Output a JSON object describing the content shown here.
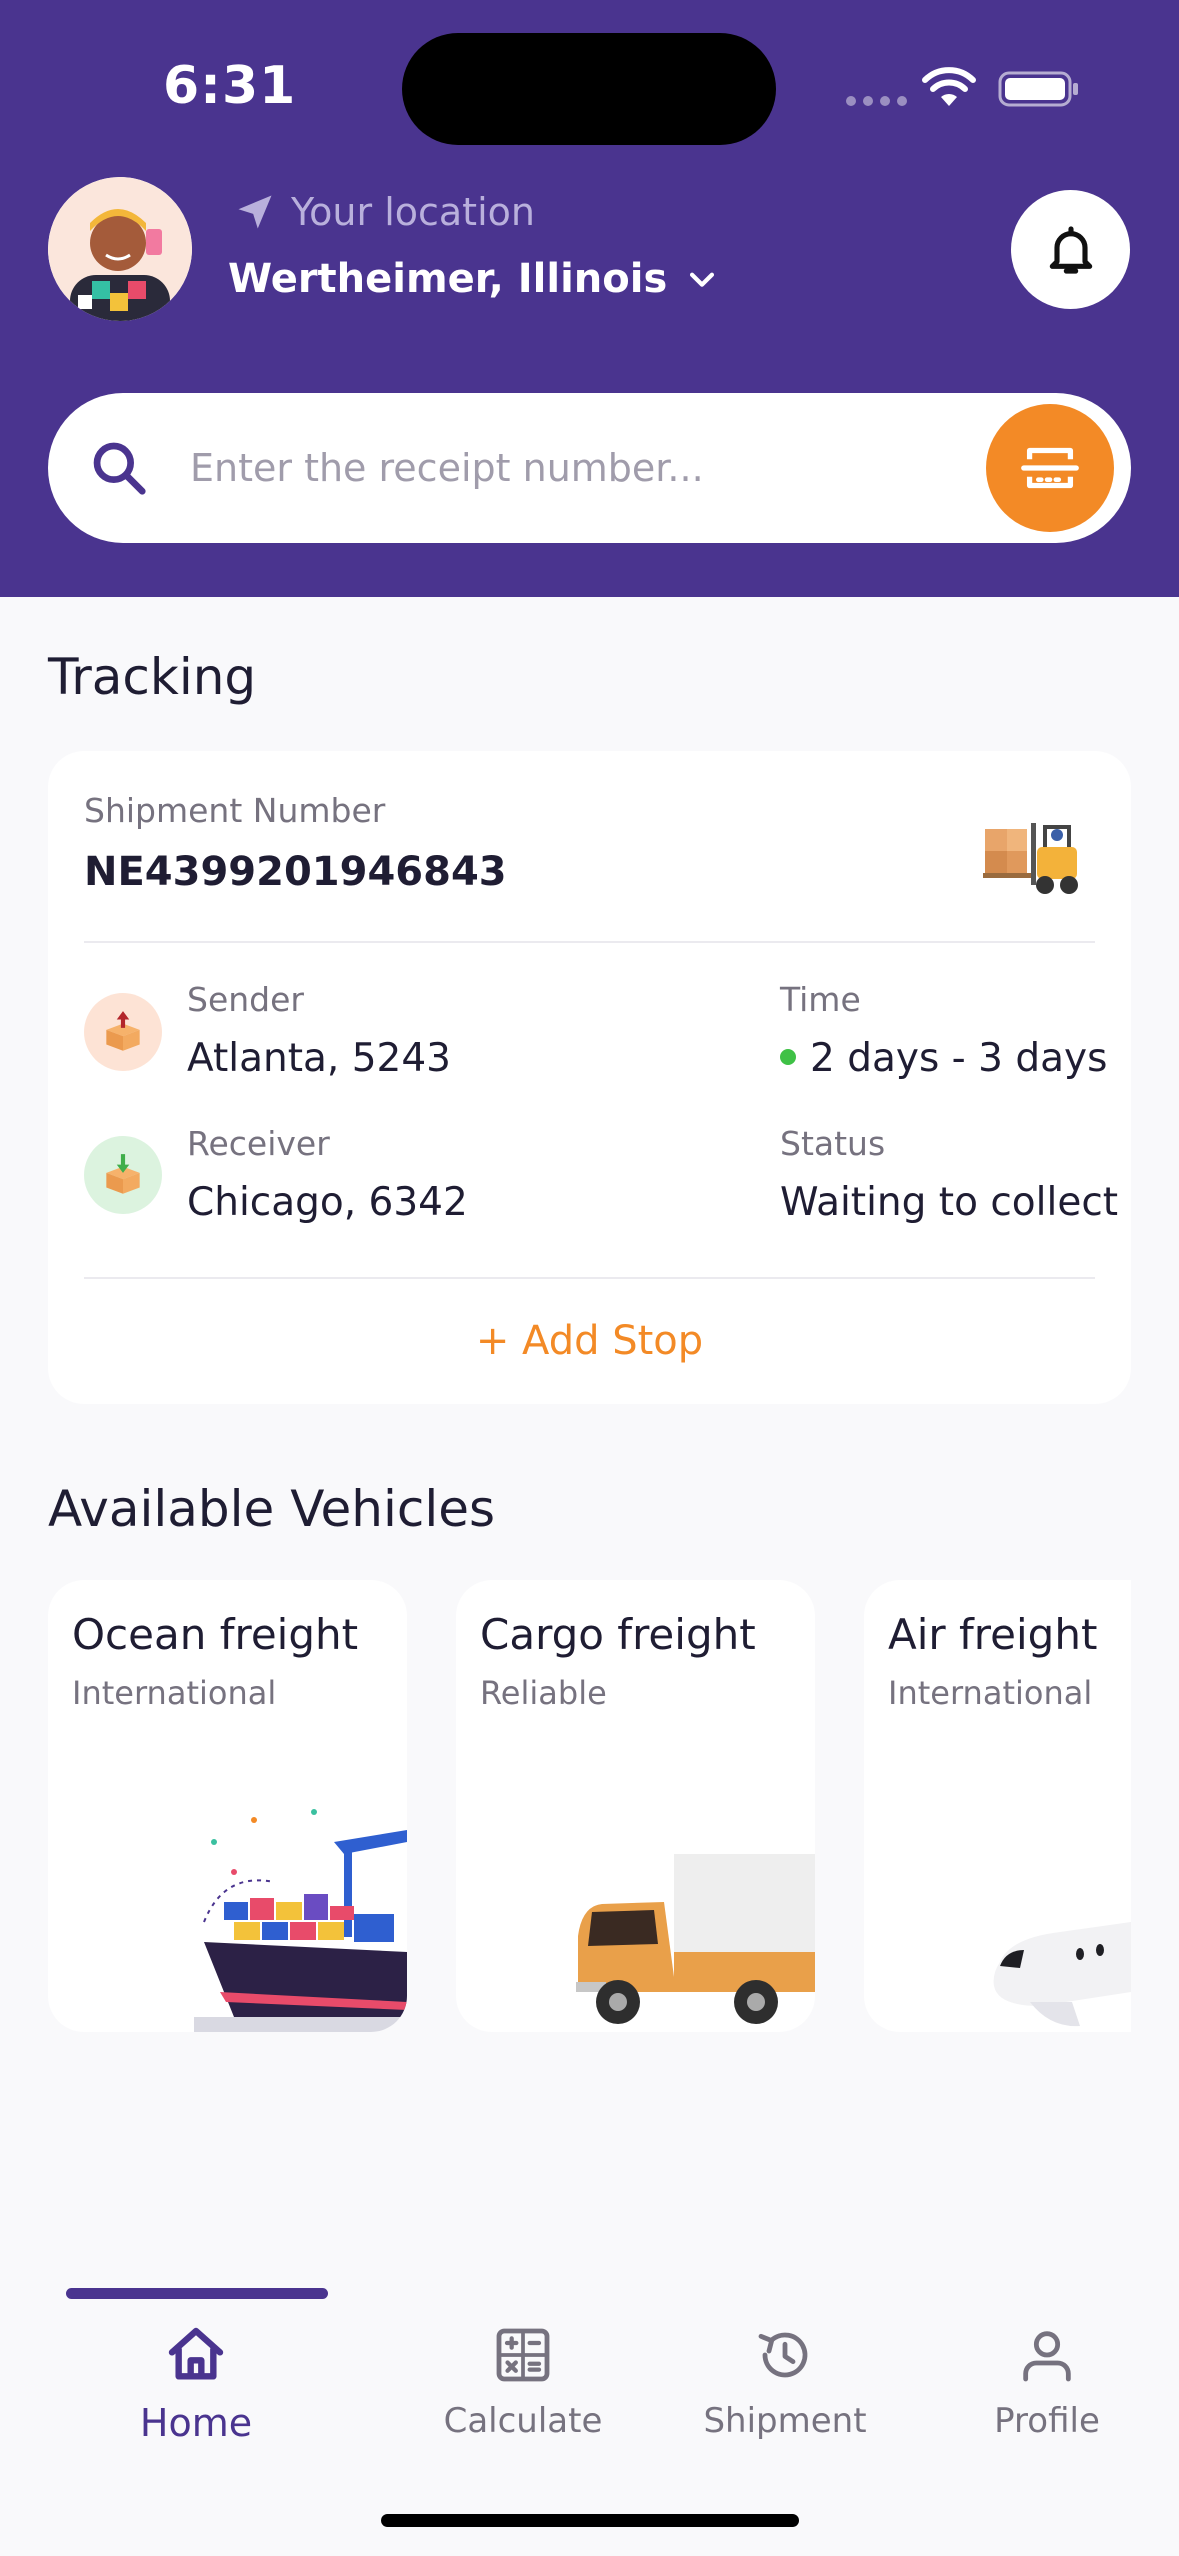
{
  "status_bar": {
    "time": "6:31"
  },
  "header": {
    "location_label": "Your location",
    "location_value": "Wertheimer, Illinois",
    "search_placeholder": "Enter the receipt number..."
  },
  "tracking": {
    "title": "Tracking",
    "shipment_label": "Shipment Number",
    "shipment_number": "NE4399201946843",
    "sender_label": "Sender",
    "sender_value": "Atlanta, 5243",
    "receiver_label": "Receiver",
    "receiver_value": "Chicago, 6342",
    "time_label": "Time",
    "time_value": "2 days - 3 days",
    "status_label": "Status",
    "status_value": "Waiting to collect",
    "add_stop": "+ Add Stop"
  },
  "vehicles": {
    "title": "Available Vehicles",
    "items": [
      {
        "title": "Ocean freight",
        "subtitle": "International",
        "icon": "ship-icon"
      },
      {
        "title": "Cargo freight",
        "subtitle": "Reliable",
        "icon": "truck-icon"
      },
      {
        "title": "Air freight",
        "subtitle": "International",
        "icon": "plane-icon"
      }
    ]
  },
  "tabbar": {
    "items": [
      {
        "label": "Home",
        "icon": "home-icon",
        "active": true
      },
      {
        "label": "Calculate",
        "icon": "calculator-icon",
        "active": false
      },
      {
        "label": "Shipment",
        "icon": "history-icon",
        "active": false
      },
      {
        "label": "Profile",
        "icon": "user-icon",
        "active": false
      }
    ]
  },
  "colors": {
    "primary": "#4a348f",
    "accent": "#f38a26",
    "success": "#3fc146",
    "background": "#f9f9fb"
  }
}
